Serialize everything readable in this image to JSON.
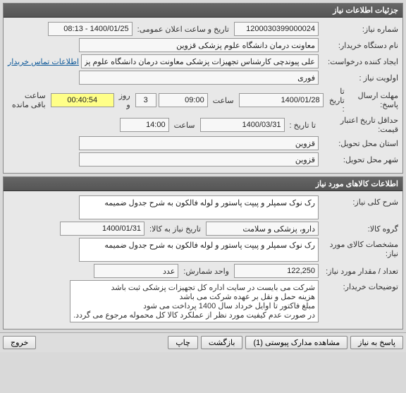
{
  "panel1": {
    "title": "جزئیات اطلاعات نیاز",
    "req_number_label": "شماره نیاز:",
    "req_number": "1200030399000024",
    "public_date_label": "تاریخ و ساعت اعلان عمومی:",
    "public_date": "1400/01/25 - 08:13",
    "buyer_label": "نام دستگاه خریدار:",
    "buyer": "معاونت درمان دانشگاه علوم پزشکی قزوین",
    "creator_label": "ایجاد کننده درخواست:",
    "creator": "علی پیوندچی کارشناس تجهیزات پزشکی معاونت درمان دانشگاه علوم پزشکی قزوین",
    "contact_link": "اطلاعات تماس خریدار",
    "priority_label": "اولویت نیاز :",
    "priority": "فوری",
    "deadline_label": "مهلت ارسال پاسخ:",
    "to_date_label": "تا تاریخ :",
    "deadline_date": "1400/01/28",
    "time_label": "ساعت",
    "deadline_time": "09:00",
    "days": "3",
    "days_label": "روز و",
    "countdown": "00:40:54",
    "remain_label": "ساعت باقی مانده",
    "validity_label": "حداقل تاریخ اعتبار قیمت:",
    "to_date_label2": "تا تاریخ :",
    "validity_date": "1400/03/31",
    "validity_time": "14:00",
    "province_label": "استان محل تحویل:",
    "province": "قزوین",
    "city_label": "شهر محل تحویل:",
    "city": "قزوین"
  },
  "panel2": {
    "title": "اطلاعات کالاهای مورد نیاز",
    "general_desc_label": "شرح کلی نیاز:",
    "general_desc": "رک نوک سمپلر و پیپت پاستور و لوله فالکون به شرح جدول ضمیمه",
    "group_label": "گروه کالا:",
    "group": "دارو، پزشکی و سلامت",
    "need_date_label": "تاریخ نیاز به کالا:",
    "need_date": "1400/01/31",
    "spec_label": "مشخصات کالای مورد نیاز:",
    "spec": "رک نوک سمپلر و پیپت پاستور و لوله فالکون به شرح جدول ضمیمه",
    "qty_label": "تعداد / مقدار مورد نیاز:",
    "qty": "122,250",
    "unit_label": "واحد شمارش:",
    "unit": "عدد",
    "notes_label": "توضیحات خریدار:",
    "notes": "شرکت می بایست در سایت اداره کل تجهیزات پزشکی ثبت باشد\nهزینه حمل و نقل بر عهده شرکت می باشد\nمبلغ فاکتور تا اوایل خرداد سال 1400 پرداخت می شود\nدر صورت عدم کیفیت مورد نظر از عملکرد کالا کل محموله مرجوع می گردد."
  },
  "buttons": {
    "respond": "پاسخ به نیاز",
    "attachments": "مشاهده مدارک پیوستی (1)",
    "back": "بازگشت",
    "print": "چاپ",
    "exit": "خروج"
  }
}
